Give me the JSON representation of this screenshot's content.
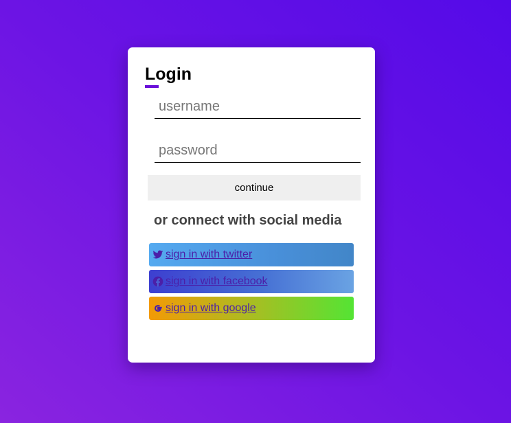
{
  "login": {
    "title": "Login",
    "username_placeholder": "username",
    "password_placeholder": "password",
    "continue_label": "continue"
  },
  "social": {
    "heading": "or connect with social media",
    "twitter_label": " sign in with twitter",
    "facebook_label": " sign in with facebook",
    "google_label": " sign in with google",
    "twitter_icon": "twitter-icon",
    "facebook_icon": "facebook-icon",
    "google_icon": "google-icon"
  },
  "colors": {
    "accent": "#6a0fd9",
    "link": "#4b1fa8"
  }
}
